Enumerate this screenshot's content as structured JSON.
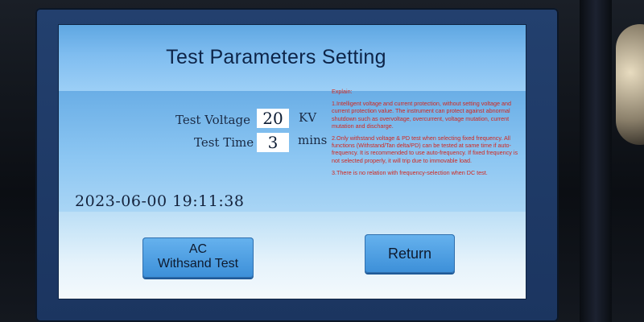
{
  "screen": {
    "title": "Test Parameters Setting"
  },
  "params": {
    "voltage_label": "Test Voltage",
    "voltage_value": "20",
    "voltage_unit": "KV",
    "time_label": "Test Time",
    "time_value": "3",
    "time_unit": "mins"
  },
  "datetime": "2023-06-00 19:11:38",
  "explain": {
    "heading": "Explain:",
    "items": [
      "1.Intelligent voltage and current protection, without setting voltage and current protection value. The instrument can protect against abnormal shutdown such as overvoltage, overcurrent, voltage mutation, current mutation and discharge.",
      "2.Only withstand voltage & PD test when selecting fixed frequency. All functions (Withstand/Tan delta/PD) can be tested at same time if auto-frequency. It is recommended to use auto-frequency. If fixed frequency is not selected properly, it will trip due to immovable load.",
      "3.There is no relation with frequency-selection when DC test."
    ]
  },
  "buttons": {
    "ac_line1": "AC",
    "ac_line2": "Withsand Test",
    "return": "Return"
  }
}
